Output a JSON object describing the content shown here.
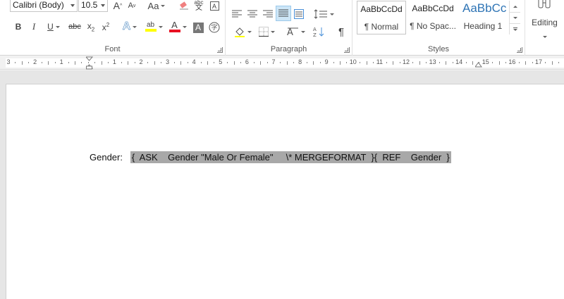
{
  "font": {
    "name": "Calibri (Body)",
    "size": "10.5",
    "grow_label": "A",
    "shrink_label": "A",
    "case_label": "Aa",
    "bold": "B",
    "italic": "I",
    "underline": "U",
    "strike": "abc",
    "subscript_base": "x",
    "subscript_sub": "2",
    "superscript_base": "x",
    "superscript_sup": "2",
    "effects_label": "A",
    "highlight_label": "ab",
    "color_label": "A",
    "shade_label": "A",
    "phonetic_label": "abc",
    "group_label": "Font"
  },
  "paragraph": {
    "group_label": "Paragraph",
    "pilcrow": "¶"
  },
  "styles": {
    "group_label": "Styles",
    "items": [
      {
        "sample": "AaBbCcDd",
        "name": "¶ Normal"
      },
      {
        "sample": "AaBbCcDd",
        "name": "¶ No Spac..."
      },
      {
        "sample": "AaBbCc",
        "name": "Heading 1"
      }
    ]
  },
  "editing": {
    "label": "Editing"
  },
  "ruler": {
    "labels": [
      "3",
      "2",
      "1",
      "1",
      "2",
      "3",
      "4",
      "5",
      "6",
      "7",
      "8",
      "9",
      "10",
      "11",
      "12",
      "13",
      "14",
      "15",
      "16",
      "17"
    ]
  },
  "document": {
    "label": "Gender:",
    "field_code": "{  ASK    Gender \"Male Or Female\"     \\* MERGEFORMAT  }{  REF    Gender  }"
  },
  "colors": {
    "highlight": "#ffff00",
    "font_color": "#e81123",
    "heading_blue": "#2e74b5",
    "field_shade": "#a8a8a8"
  }
}
